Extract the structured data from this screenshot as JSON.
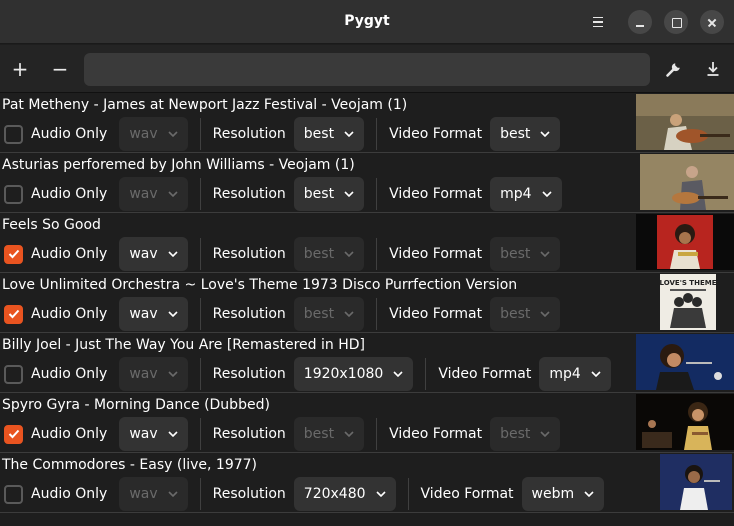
{
  "window": {
    "title": "Pygyt"
  },
  "toolbar": {
    "add_label": "+",
    "remove_label": "−",
    "url_value": ""
  },
  "labels": {
    "audio_only": "Audio Only",
    "resolution": "Resolution",
    "video_format": "Video Format"
  },
  "items": [
    {
      "title": "Pat Metheny - James at Newport Jazz Festival - Veojam (1)",
      "audio_only": false,
      "audio_format": "wav",
      "resolution": "best",
      "video_format": "best"
    },
    {
      "title": "Asturias perforemed by John Williams - Veojam (1)",
      "audio_only": false,
      "audio_format": "wav",
      "resolution": "best",
      "video_format": "mp4"
    },
    {
      "title": "Feels So Good",
      "audio_only": true,
      "audio_format": "wav",
      "resolution": "best",
      "video_format": "best"
    },
    {
      "title": "Love Unlimited Orchestra ~ Love's Theme 1973 Disco Purrfection Version",
      "audio_only": true,
      "audio_format": "wav",
      "resolution": "best",
      "video_format": "best",
      "thumb_text": "LOVE'S THEME"
    },
    {
      "title": "Billy Joel - Just The Way You Are [Remastered in HD]",
      "audio_only": false,
      "audio_format": "wav",
      "resolution": "1920x1080",
      "video_format": "mp4"
    },
    {
      "title": "Spyro Gyra - Morning Dance (Dubbed)",
      "audio_only": true,
      "audio_format": "wav",
      "resolution": "best",
      "video_format": "best"
    },
    {
      "title": "The Commodores - Easy (live, 1977)",
      "audio_only": false,
      "audio_format": "wav",
      "resolution": "720x480",
      "video_format": "webm"
    }
  ],
  "colors": {
    "accent": "#e95420",
    "background": "#1e1e1e",
    "headerbar": "#303030"
  },
  "icons": {
    "menu": "hamburger-menu-icon",
    "settings": "wrench-icon",
    "download": "download-icon",
    "dropdown": "chevron-down-icon"
  }
}
